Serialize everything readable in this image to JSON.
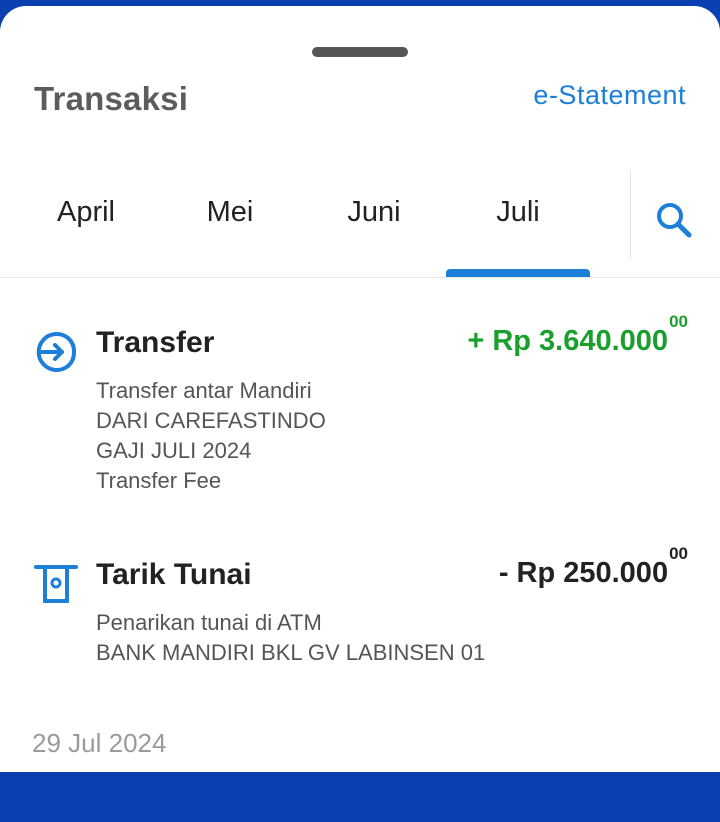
{
  "header": {
    "title": "Transaksi",
    "estatement_label": "e-Statement"
  },
  "tabs": [
    {
      "label": "April",
      "selected": false
    },
    {
      "label": "Mei",
      "selected": false
    },
    {
      "label": "Juni",
      "selected": false
    },
    {
      "label": "Juli",
      "selected": true
    }
  ],
  "search": {
    "icon": "search-icon"
  },
  "transactions": [
    {
      "icon": "transfer-in-icon",
      "title": "Transfer",
      "amount_main": "+ Rp 3.640.000",
      "amount_cents": "00",
      "amount_color": "#1a9e2c",
      "lines": [
        "Transfer antar Mandiri",
        "DARI CAREFASTINDO",
        "GAJI JULI 2024",
        "Transfer Fee"
      ]
    },
    {
      "icon": "atm-withdraw-icon",
      "title": "Tarik Tunai",
      "amount_main": "- Rp 250.000",
      "amount_cents": "00",
      "amount_color": "#222222",
      "lines": [
        "Penarikan tunai di ATM",
        "BANK MANDIRI BKL GV LABINSEN 01"
      ]
    }
  ],
  "date_header": "29 Jul 2024",
  "colors": {
    "accent": "#1e7fd8",
    "credit": "#1a9e2c",
    "top_bar": "#0a3fb0"
  }
}
